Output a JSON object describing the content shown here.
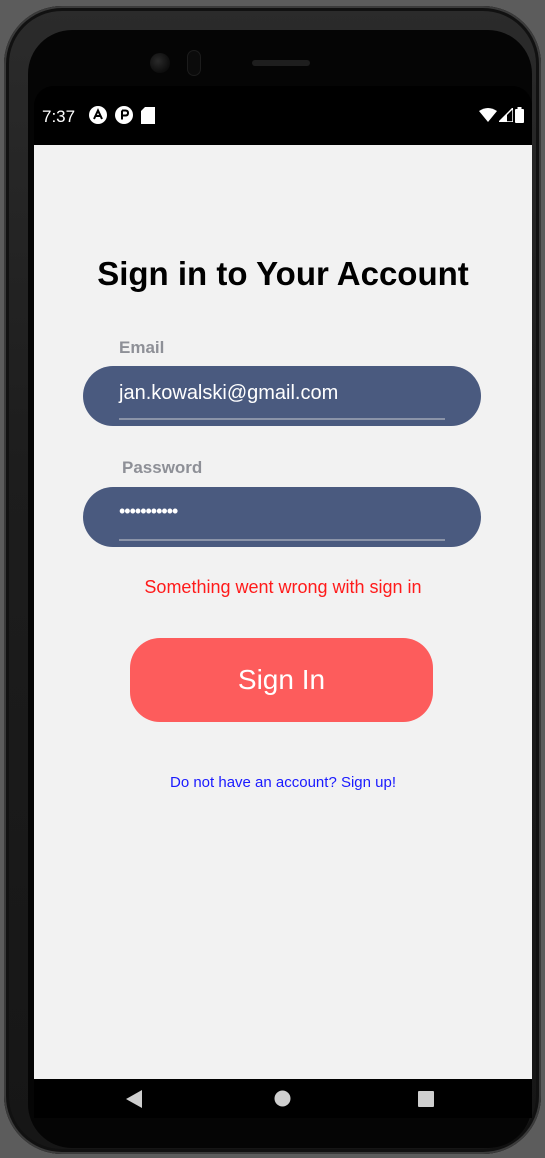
{
  "status_bar": {
    "time": "7:37",
    "left_icons": [
      "autofill-a-icon",
      "play-protect-icon",
      "sd-card-icon"
    ],
    "right_icons": [
      "wifi-icon",
      "signal-icon",
      "battery-icon"
    ]
  },
  "screen": {
    "title": "Sign in to Your Account",
    "email": {
      "label": "Email",
      "value": "jan.kowalski@gmail.com"
    },
    "password": {
      "label": "Password",
      "value": "•••••••••••"
    },
    "error_message": "Something went wrong with sign in",
    "sign_in_label": "Sign In",
    "sign_up_link": "Do not have an account? Sign up!"
  },
  "nav_bar": {
    "icons": [
      "back-triangle-icon",
      "home-circle-icon",
      "recents-square-icon"
    ]
  },
  "colors": {
    "background": "#f2f2f2",
    "field": "#4a5a7f",
    "button": "#fd5c5c",
    "error": "#ff1a1a",
    "link": "#1a1aff",
    "label": "#8e9097"
  }
}
